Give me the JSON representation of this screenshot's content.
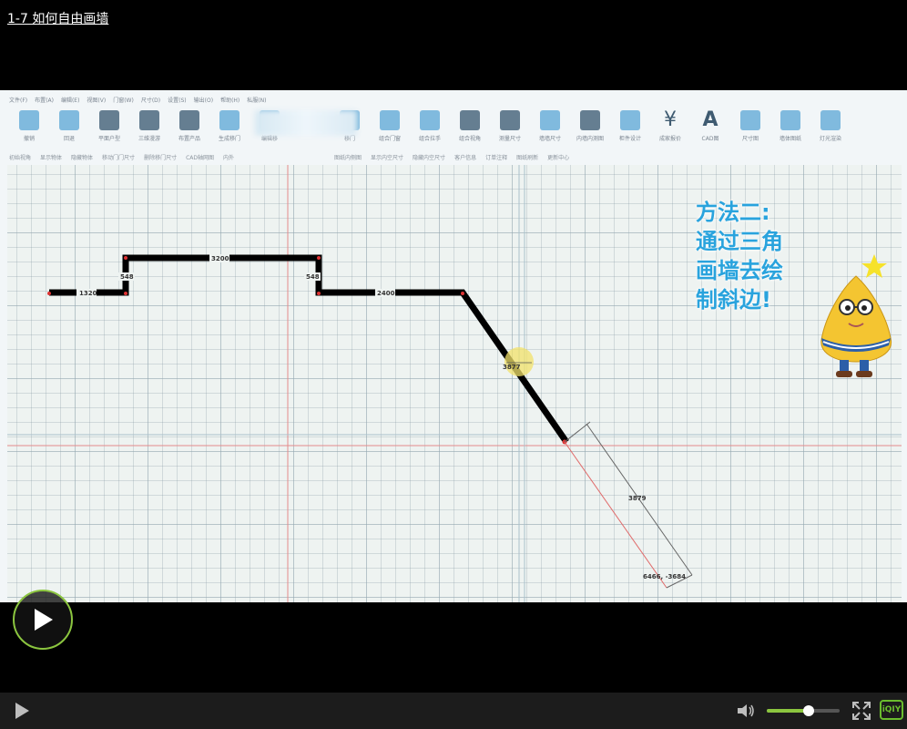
{
  "video": {
    "title": "1-7   如何自由画墙"
  },
  "app": {
    "menu": [
      "文件(F)",
      "布置(A)",
      "编辑(E)",
      "视图(V)",
      "门窗(W)",
      "尺寸(D)",
      "设置(S)",
      "输出(O)",
      "帮助(H)",
      "私服(N)"
    ],
    "toolbar": [
      {
        "label": "撤销",
        "icon": "undo-icon"
      },
      {
        "label": "回退",
        "icon": "redo-icon"
      },
      {
        "label": "平面户型",
        "icon": "floorplan-icon"
      },
      {
        "label": "三维漫游",
        "icon": "3d-view-icon"
      },
      {
        "label": "布置产品",
        "icon": "place-product-icon"
      },
      {
        "label": "生成移门",
        "icon": "sliding-door-icon"
      },
      {
        "label": "编辑移",
        "icon": "edit-door-icon"
      },
      {
        "label": "",
        "icon": "blurred-icon"
      },
      {
        "label": "移门",
        "icon": "door-icon"
      },
      {
        "label": "组合门窗",
        "icon": "combine-door-icon"
      },
      {
        "label": "组合拉手",
        "icon": "combine-handle-icon"
      },
      {
        "label": "组合视角",
        "icon": "combine-view-icon"
      },
      {
        "label": "测量尺寸",
        "icon": "measure-icon"
      },
      {
        "label": "墙墙尺寸",
        "icon": "wall-size-icon"
      },
      {
        "label": "内墙内测图",
        "icon": "inner-wall-icon"
      },
      {
        "label": "柜件设计",
        "icon": "cabinet-icon"
      },
      {
        "label": "成家报价",
        "icon": "quote-icon"
      },
      {
        "label": "CAD图",
        "icon": "cad-icon"
      },
      {
        "label": "尺寸图",
        "icon": "dimension-icon"
      },
      {
        "label": "墙体图纸",
        "icon": "wall-drawing-icon"
      },
      {
        "label": "灯光渲染",
        "icon": "render-icon"
      }
    ],
    "subbar": [
      "初始视角",
      "显示物体",
      "隐藏物体",
      "移动门门尺寸",
      "删除移门尺寸",
      "CAD轴网图",
      "内外",
      "",
      "图纸内侧图",
      "显示内空尺寸",
      "隐藏内空尺寸",
      "客户信息",
      "订单注释",
      "图纸刷新",
      "更新中心"
    ]
  },
  "drawing": {
    "dimensions": [
      "1320",
      "548",
      "3200",
      "548",
      "2400",
      "3877",
      "3879",
      "6466, -3684"
    ],
    "caption_lines": [
      "方法二:",
      "通过三角",
      "画墙去绘",
      "制斜边!"
    ]
  },
  "player": {
    "brand": "iQIY",
    "volume_fraction": 0.58,
    "colors": {
      "accent": "#8bc53f",
      "caption": "#29a3dd"
    }
  }
}
